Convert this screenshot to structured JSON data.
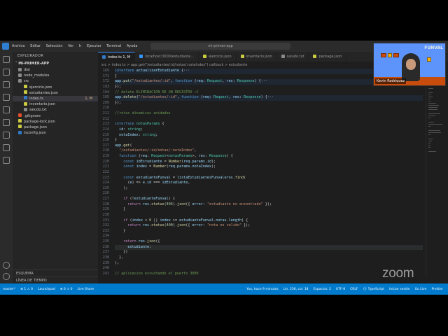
{
  "titlebar": {
    "menu": [
      "Archivo",
      "Editar",
      "Selección",
      "Ver",
      "Ir",
      "Ejecutar",
      "Terminal",
      "Ayuda"
    ],
    "search": "mi-primer-app"
  },
  "sidebar": {
    "header": "EXPLORADOR",
    "project": "MI-PRIMER-APP",
    "items": [
      {
        "label": "dist",
        "type": "folder",
        "color": "#8a8a8a",
        "indent": 1
      },
      {
        "label": "node_modules",
        "type": "folder",
        "color": "#8a8a8a",
        "indent": 1
      },
      {
        "label": "src",
        "type": "folder",
        "color": "#8a8a8a",
        "indent": 1
      },
      {
        "label": "ejercicio.json",
        "type": "json",
        "color": "#cbcb41",
        "indent": 2
      },
      {
        "label": "estudiantes.json",
        "type": "json",
        "color": "#cbcb41",
        "indent": 2
      },
      {
        "label": "index.ts",
        "type": "ts",
        "color": "#3178c6",
        "indent": 2,
        "active": true,
        "mod": "1, M"
      },
      {
        "label": "inventario.json",
        "type": "json",
        "color": "#cbcb41",
        "indent": 2
      },
      {
        "label": "saludo.txt",
        "type": "txt",
        "color": "#8a8a8a",
        "indent": 2
      },
      {
        "label": ".gitignore",
        "type": "git",
        "color": "#e24c2c",
        "indent": 1
      },
      {
        "label": "package-lock.json",
        "type": "json",
        "color": "#cbcb41",
        "indent": 1
      },
      {
        "label": "package.json",
        "type": "json",
        "color": "#cbcb41",
        "indent": 1
      },
      {
        "label": "tsconfig.json",
        "type": "json",
        "color": "#3178c6",
        "indent": 1
      }
    ],
    "outline": "ESQUEMA",
    "timeline": "LÍNEA DE TIEMPO"
  },
  "tabs": [
    {
      "label": "index.ts 1, M",
      "color": "#3178c6",
      "active": true
    },
    {
      "label": "localhost:3000/estudiante...",
      "color": "#3794ff"
    },
    {
      "label": "ejercicio.json",
      "color": "#cbcb41"
    },
    {
      "label": "inventario.json",
      "color": "#cbcb41"
    },
    {
      "label": "saludo.txt",
      "color": "#8a8a8a"
    },
    {
      "label": "package.json",
      "color": "#cbcb41"
    }
  ],
  "breadcrumb": "src > index.ts > app.get(\"/estudiantes/:id/notas/:notaIndex\") callback > estudiante",
  "editor": {
    "lines": [
      {
        "n": "169",
        "text": "interface actualizarEstudiante {···",
        "cls": "folded"
      },
      {
        "n": "171",
        "text": "}"
      },
      {
        "n": "172",
        "text": "app.put(\"/estudiantes/:id\", function (req: Request, res: Response) {···",
        "cls": "folded"
      },
      {
        "n": "193",
        "text": "});"
      },
      {
        "n": "194",
        "text": "// delete ELIMINACION DE UN REGISTRO :C"
      },
      {
        "n": "195",
        "text": "app.delete(\"/estudiantes/:id\", function (req: Request, res: Response) {···",
        "cls": "folded"
      },
      {
        "n": "209",
        "text": "});"
      },
      {
        "n": "210",
        "text": ""
      },
      {
        "n": "211",
        "text": "//rutas dinamicas anidadas"
      },
      {
        "n": "212",
        "text": ""
      },
      {
        "n": "213",
        "text": "interface notasParams {"
      },
      {
        "n": "214",
        "text": "  id: string;"
      },
      {
        "n": "215",
        "text": "  notaIndex: string;"
      },
      {
        "n": "216",
        "text": "}"
      },
      {
        "n": "217",
        "text": "app.get("
      },
      {
        "n": "218",
        "text": "  \"/estudiantes/:id/notas/:notaIndex\","
      },
      {
        "n": "219",
        "text": "  function (req: Request<notasParams>, res: Response) {"
      },
      {
        "n": "220",
        "text": "    const idEstudiante = Number(req.params.id);"
      },
      {
        "n": "221",
        "text": "    const index = Number(req.params.notaIndex);"
      },
      {
        "n": "222",
        "text": ""
      },
      {
        "n": "223",
        "text": "    const estudianteFunval = listaEstudiantesFunvaleros.find("
      },
      {
        "n": "224",
        "text": "      (e) => e.id === idEstudiante,"
      },
      {
        "n": "225",
        "text": "    );"
      },
      {
        "n": "226",
        "text": ""
      },
      {
        "n": "227",
        "text": "    if (!estudianteFunval) {"
      },
      {
        "n": "228",
        "text": "      return res.status(404).json({ error: \"estudiante no encontrado\" });"
      },
      {
        "n": "229",
        "text": "    }"
      },
      {
        "n": "230",
        "text": ""
      },
      {
        "n": "231",
        "text": "    if (index < 0 || index >= estudianteFunval.notas.length) {"
      },
      {
        "n": "232",
        "text": "      return res.status(400).json({ error: \"nota no valido\" });"
      },
      {
        "n": "233",
        "text": "    }"
      },
      {
        "n": "234",
        "text": ""
      },
      {
        "n": "235",
        "text": "    return res.json({"
      },
      {
        "n": "236",
        "text": "      estudiante:",
        "cls": "hl"
      },
      {
        "n": "237",
        "text": "    })"
      },
      {
        "n": "238",
        "text": "  },"
      },
      {
        "n": "239",
        "text": ");"
      },
      {
        "n": "240",
        "text": ""
      },
      {
        "n": "241",
        "text": "// aplicacion escuchando el puerto 3000"
      }
    ]
  },
  "statusbar": {
    "left": [
      "master*",
      "⊗ 1 ⚠ 0",
      "Launchpad",
      "⊗ 0 ⚠ 0",
      "Live Share"
    ],
    "right": [
      "You, hace 9 minutos",
      "Lín. 236, col. 18",
      "Espacios: 2",
      "UTF-8",
      "CRLF",
      "{} TypeScript",
      "Iniciar sesión",
      "Go Live",
      "Prettier"
    ]
  },
  "webcam": {
    "name": "Kevin Rodriquez",
    "logo": "FUNVAL"
  },
  "zoom_label": "zoom",
  "colors": {
    "accent": "#007acc",
    "editor_bg": "#1e1e1e",
    "sidebar_bg": "#252526"
  }
}
